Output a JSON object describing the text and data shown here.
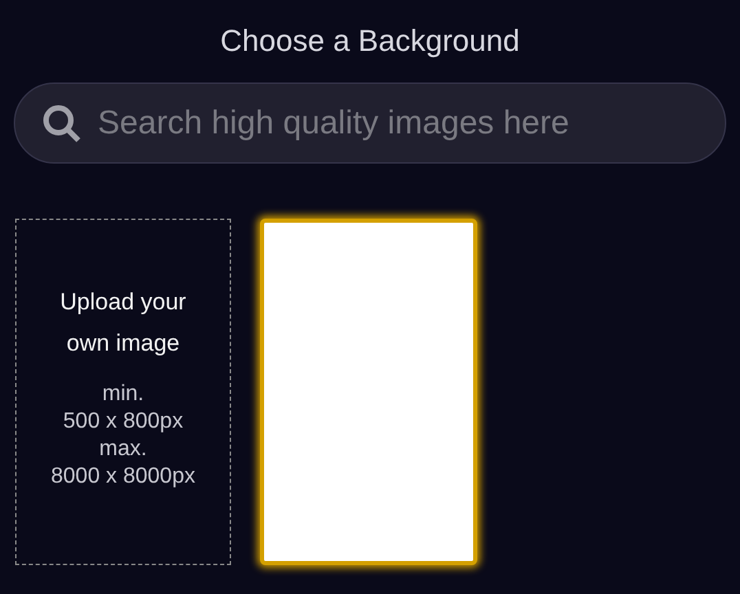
{
  "title": "Choose a Background",
  "search": {
    "placeholder": "Search high quality images here"
  },
  "upload": {
    "label": "Upload your own image",
    "requirements": [
      "min.",
      "500 x 800px",
      "max.",
      "8000 x 8000px"
    ]
  },
  "backgrounds": [
    {
      "kind": "blank",
      "selected": true
    }
  ]
}
